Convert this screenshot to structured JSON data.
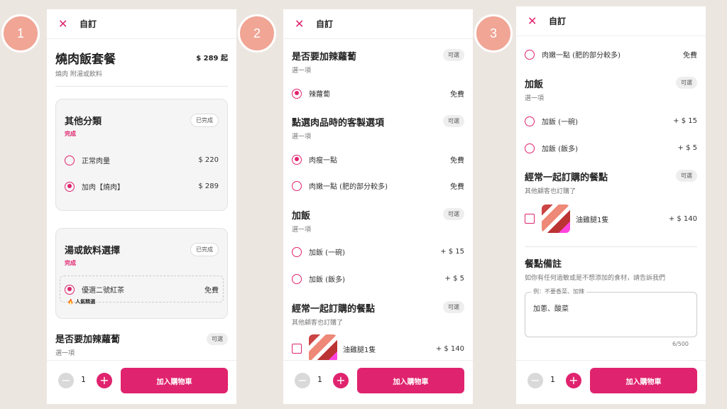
{
  "steps": [
    "1",
    "2",
    "3"
  ],
  "header": {
    "title": "自訂"
  },
  "footer": {
    "qty": "1",
    "add_label": "加入購物車"
  },
  "p1": {
    "title": "燒肉飯套餐",
    "price": "$ 289 起",
    "desc": "燒肉 附湯或飲料",
    "g1": {
      "title": "其他分類",
      "status": "完成",
      "pill": "已完成",
      "options": [
        {
          "label": "正常肉量",
          "price": "$ 220"
        },
        {
          "label": "加肉【燒肉】",
          "price": "$ 289"
        }
      ]
    },
    "g2": {
      "title": "湯或飲料選擇",
      "status": "完成",
      "pill": "已完成",
      "option": {
        "label": "優選二號紅茶",
        "price": "免費"
      },
      "hot": "人氣精選"
    },
    "g3": {
      "title": "是否要加辣蘿蔔",
      "sub": "選一項",
      "pill": "可選"
    }
  },
  "p2": {
    "s1": {
      "title": "是否要加辣蘿蔔",
      "sub": "選一項",
      "pill": "可選",
      "opt": {
        "label": "辣蘿蔔",
        "price": "免費"
      }
    },
    "s2": {
      "title": "點選肉品時的客製選項",
      "sub": "選一項",
      "pill": "可選",
      "opts": [
        {
          "label": "肉瘦一點",
          "price": "免費"
        },
        {
          "label": "肉嫩一點 (肥的部分較多)",
          "price": "免費"
        }
      ]
    },
    "s3": {
      "title": "加飯",
      "sub": "選一項",
      "pill": "可選",
      "opts": [
        {
          "label": "加飯 (一碗)",
          "price": "+ $ 15"
        },
        {
          "label": "加飯 (飯多)",
          "price": "+ $ 5"
        }
      ]
    },
    "s4": {
      "title": "經常一起訂購的餐點",
      "sub": "其他顧客也訂購了",
      "pill": "可選",
      "item": {
        "label": "油雞腿1隻",
        "price": "+ $ 140"
      }
    }
  },
  "p3": {
    "top": {
      "label": "肉嫩一點 (肥的部分較多)",
      "price": "免費"
    },
    "s3": {
      "title": "加飯",
      "sub": "選一項",
      "pill": "可選",
      "opts": [
        {
          "label": "加飯 (一碗)",
          "price": "+ $ 15"
        },
        {
          "label": "加飯 (飯多)",
          "price": "+ $ 5"
        }
      ]
    },
    "s4": {
      "title": "經常一起訂購的餐點",
      "sub": "其他顧客也訂購了",
      "pill": "可選",
      "item": {
        "label": "油雞腿1隻",
        "price": "+ $ 140"
      }
    },
    "note": {
      "title": "餐點備註",
      "sub": "如你有任何過敏或是不想添加的食材，請告訴我們",
      "placeholder": "例：不要香菜、加辣",
      "value": "加蔥、酸菜",
      "count": "6/500"
    }
  }
}
